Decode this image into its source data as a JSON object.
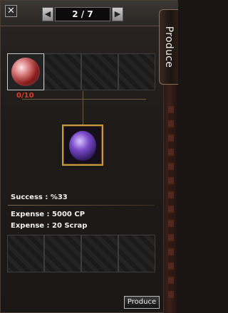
{
  "window": {
    "close_label": "✕",
    "pager": {
      "current_total": "2 / 7",
      "prev_label": "◀",
      "next_label": "▶"
    },
    "side_tab_label": "Produce"
  },
  "materials": {
    "count": "0/10"
  },
  "info": {
    "success": "Success : %33",
    "expense_cp": "Expense : 5000 CP",
    "expense_scrap": "Expense : 20 Scrap"
  },
  "actions": {
    "produce_label": "Produce"
  }
}
